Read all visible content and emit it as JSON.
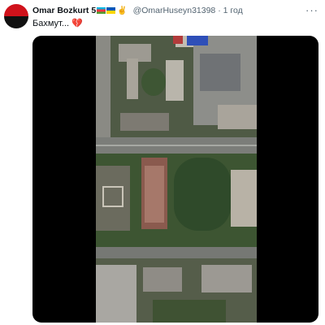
{
  "tweet": {
    "author_name": "Omar Bozkurt 5",
    "flags": [
      "azerbaijan-flag",
      "ukraine-flag"
    ],
    "emoji_after_flags": "✌",
    "handle": "@OmarHuseyn31398",
    "separator": "·",
    "time": "1 год",
    "text": "Бахмут... ",
    "text_emoji": "💔",
    "more_label": "···",
    "avatar_colors": [
      "#d0121b",
      "#111111"
    ],
    "media": {
      "type": "satellite-image",
      "background": "#000000"
    }
  }
}
